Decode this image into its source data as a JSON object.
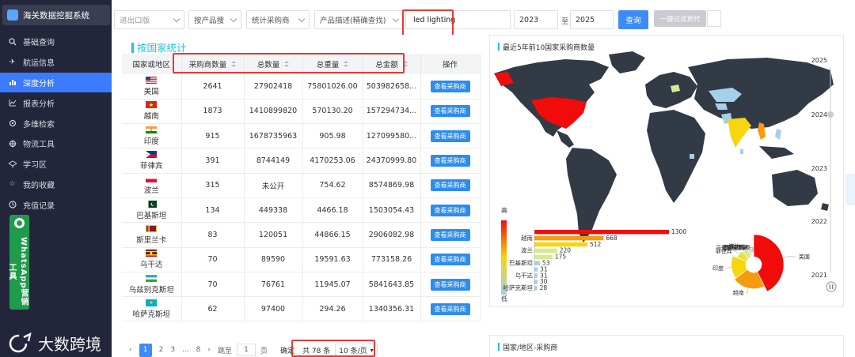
{
  "app": {
    "title": "海关数据挖掘系统"
  },
  "sidebar": {
    "items": [
      {
        "label": "基础查询",
        "icon": "search-icon"
      },
      {
        "label": "航运信息",
        "icon": "plane-icon"
      },
      {
        "label": "深度分析",
        "icon": "analysis-icon",
        "active": true
      },
      {
        "label": "报表分析",
        "icon": "report-icon"
      },
      {
        "label": "多维检索",
        "icon": "multi-search-icon"
      },
      {
        "label": "物流工具",
        "icon": "logistics-icon"
      },
      {
        "label": "学习区",
        "icon": "study-icon"
      },
      {
        "label": "我的收藏",
        "icon": "star-icon"
      },
      {
        "label": "充值记录",
        "icon": "record-icon"
      }
    ],
    "whatsapp_label": "WhatsApp营销工具",
    "watermark": "大数跨境"
  },
  "filters": {
    "trade_type": "进出口版",
    "search_mode": "按产品搜",
    "stat_target": "统计采购商",
    "desc_mode": "产品描述(精确查找)",
    "keyword": "led lighting",
    "year_from": "2023",
    "to_label": "至",
    "year_to": "2025",
    "query_button": "查询",
    "filter_button": "一键过滤货代"
  },
  "table": {
    "section_title": "按国家统计",
    "columns": [
      "国家或地区",
      "采购商数量",
      "总数量",
      "总重量",
      "总金额",
      "操作"
    ],
    "action_label": "查看采购商",
    "rows": [
      {
        "country": "美国",
        "flag": "us",
        "buyers": "2641",
        "qty": "27902418",
        "weight": "75801026.00",
        "amount": "503982658..."
      },
      {
        "country": "越南",
        "flag": "vn",
        "buyers": "1873",
        "qty": "1410899820",
        "weight": "570130.20",
        "amount": "157294734..."
      },
      {
        "country": "印度",
        "flag": "in",
        "buyers": "915",
        "qty": "1678735963",
        "weight": "905.98",
        "amount": "127099580..."
      },
      {
        "country": "菲律宾",
        "flag": "ph",
        "buyers": "391",
        "qty": "8744149",
        "weight": "4170253.06",
        "amount": "24370999.80"
      },
      {
        "country": "波兰",
        "flag": "pl",
        "buyers": "315",
        "qty": "未公开",
        "weight": "754.62",
        "amount": "8574869.98"
      },
      {
        "country": "巴基斯坦",
        "flag": "pk",
        "buyers": "134",
        "qty": "449338",
        "weight": "4466.18",
        "amount": "1503054.43"
      },
      {
        "country": "斯里兰卡",
        "flag": "lk",
        "buyers": "83",
        "qty": "120051",
        "weight": "44866.15",
        "amount": "2906082.98"
      },
      {
        "country": "乌干达",
        "flag": "ug",
        "buyers": "70",
        "qty": "89590",
        "weight": "19591.63",
        "amount": "773158.26"
      },
      {
        "country": "乌兹别克斯坦",
        "flag": "uz",
        "buyers": "70",
        "qty": "76761",
        "weight": "11945.07",
        "amount": "5841643.85"
      },
      {
        "country": "哈萨克斯坦",
        "flag": "kz",
        "buyers": "62",
        "qty": "97400",
        "weight": "294.26",
        "amount": "1340356.31"
      }
    ]
  },
  "pager": {
    "pages": [
      "1",
      "2",
      "3",
      "...",
      "8"
    ],
    "goto_label": "跳至",
    "goto_value": "1",
    "page_suffix": "页",
    "confirm": "确定",
    "total": "共 78 条",
    "page_size": "10 条/页"
  },
  "map_panel": {
    "title": "最近5年前10国家采购商数量",
    "timeline_years": [
      "2025",
      "2024",
      "2023",
      "2022",
      "2021"
    ],
    "legend_high": "高",
    "legend_low": "低",
    "colors": {
      "high": "#f20b0b",
      "mid": "#f5d60f",
      "low": "#a6cfe9",
      "land": "#323a46"
    }
  },
  "chart_data": [
    {
      "type": "bar",
      "orientation": "horizontal",
      "title": "",
      "categories": [
        "美国",
        "越南",
        "印度",
        "菲律宾",
        "波兰",
        "巴基斯坦",
        "斯里兰卡",
        "乌干达",
        "乌兹别克斯坦",
        "哈萨克斯坦"
      ],
      "category_labels_shown": [
        "",
        "越南",
        "",
        "波兰",
        "",
        "巴基斯坦",
        "",
        "乌干达",
        "",
        "哈萨克斯坦"
      ],
      "values": [
        1300,
        668,
        512,
        220,
        175,
        53,
        31,
        31,
        30,
        28
      ]
    },
    {
      "type": "pie",
      "style": "rose",
      "title": "",
      "labels": [
        "美国",
        "越南",
        "印度",
        "菲律宾",
        "波兰",
        "巴基斯坦",
        "斯里兰卡",
        "乌干达",
        "乌兹别克斯坦",
        "哈萨克斯坦"
      ],
      "values": [
        1300,
        668,
        512,
        220,
        175,
        53,
        31,
        31,
        30,
        28
      ]
    }
  ],
  "panel2": {
    "title": "国家/地区-采购商"
  }
}
